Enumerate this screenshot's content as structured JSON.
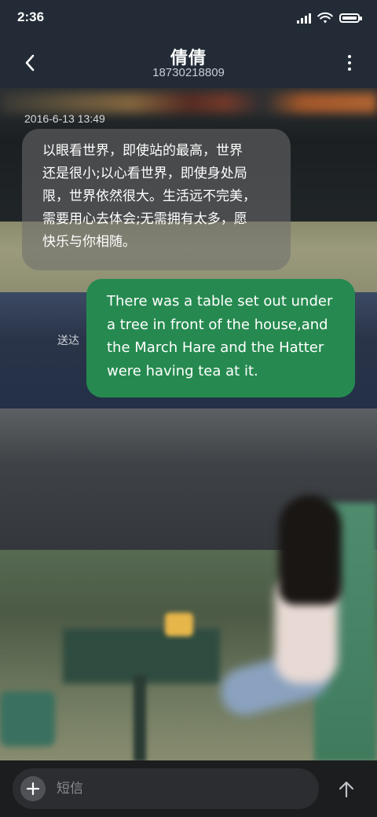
{
  "status_bar": {
    "time": "2:36",
    "battery_level": 1.0
  },
  "header": {
    "title": "倩倩",
    "subtitle": "18730218809",
    "back_icon": "chevron-left-icon",
    "more_icon": "vertical-dots-icon"
  },
  "conversation": {
    "timestamp": "2016-6-13 13:49",
    "incoming_message": {
      "lines": [
        "以眼看世界，即使站的最高，世界",
        "还是很小;以心看世界，即使身处局",
        "限，世界依然很大。生活远不完美，",
        "需要用心去体会;无需拥有太多，愿",
        "快乐与你相随。"
      ]
    },
    "outgoing_message": {
      "lines": [
        "There was a table set out under",
        "a tree in front of the house,and",
        "the March Hare and the Hatter",
        "were having tea at it."
      ],
      "status": "送达",
      "bubble_color": "#268a50"
    }
  },
  "composer": {
    "placeholder": "短信",
    "value": "",
    "add_icon": "plus-icon",
    "send_icon": "arrow-up-icon"
  }
}
